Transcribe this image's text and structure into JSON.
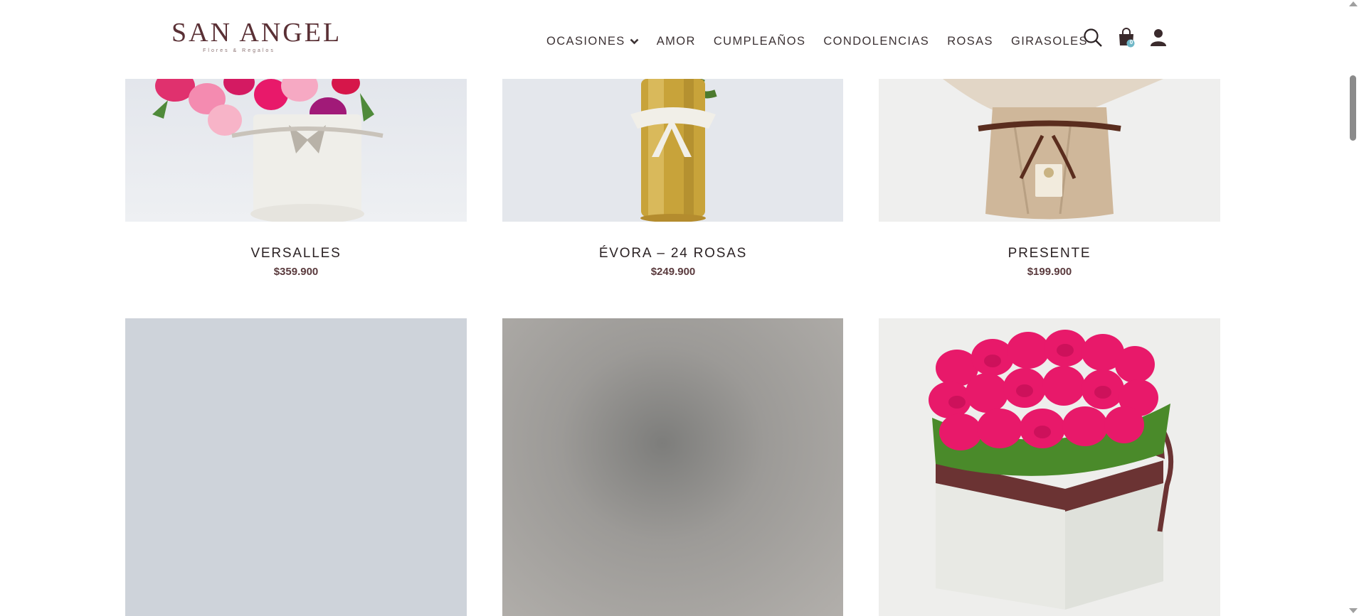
{
  "brand": {
    "name": "SAN ANGEL",
    "tagline": "Flores & Regalos",
    "color": "#5a3035"
  },
  "nav": {
    "items": [
      {
        "label": "OCASIONES",
        "has_dropdown": true
      },
      {
        "label": "AMOR"
      },
      {
        "label": "CUMPLEAÑOS"
      },
      {
        "label": "CONDOLENCIAS"
      },
      {
        "label": "ROSAS"
      },
      {
        "label": "GIRASOLES"
      }
    ],
    "icons": [
      "search-icon",
      "shopping-bag-icon",
      "user-icon"
    ],
    "cart_count": "0"
  },
  "products": [
    {
      "name": "VERSALLES",
      "price": "$359.900"
    },
    {
      "name": "ÉVORA – 24 ROSAS",
      "price": "$249.900"
    },
    {
      "name": "PRESENTE",
      "price": "$199.900"
    }
  ],
  "colors": {
    "accent": "#5a3035",
    "price": "#5a3a3d",
    "rose_pink": "#e8196a"
  }
}
